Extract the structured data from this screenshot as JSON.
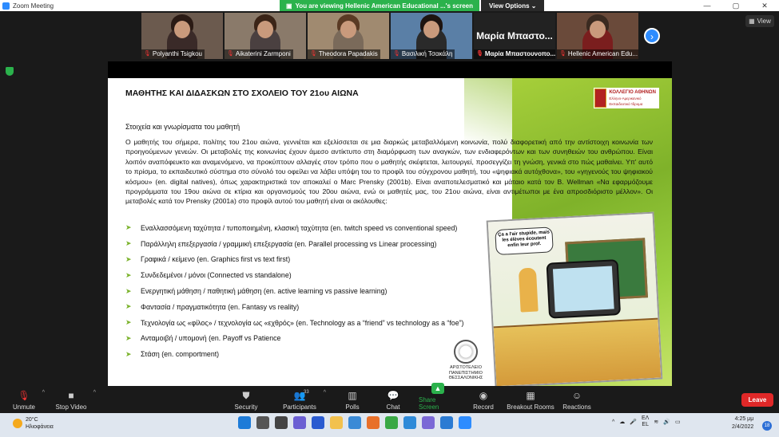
{
  "window": {
    "title": "Zoom Meeting",
    "controls": [
      "—",
      "▢",
      "✕"
    ]
  },
  "share_banner": {
    "text": "You are viewing Hellenic American Educational ...'s screen",
    "view_options": "View Options"
  },
  "participants": [
    {
      "name": "Polyanthi Tsigkou",
      "color": "#6b5a4e",
      "hair": "#2a1a14",
      "shirt": "#3a2a28"
    },
    {
      "name": "Aikaterini Zarmponi",
      "color": "#8a7a6a",
      "hair": "#3b2417",
      "shirt": "#4a4040"
    },
    {
      "name": "Theodora Papadakis",
      "color": "#a08a70",
      "hair": "#5a3a24",
      "shirt": "#7a6a5a"
    },
    {
      "name": "Βασιλική Τσακάλη",
      "color": "#5a7fa6",
      "hair": "#1e1410",
      "shirt": "#2a2a2a"
    },
    {
      "name": "Μαρία Μπαστουνοπο...",
      "display": "Μαρία Μπαστο..."
    },
    {
      "name": "Hellenic American Edu...",
      "color": "#6a4a3a",
      "hair": "#3a2a20",
      "shirt": "#7a1e1e"
    }
  ],
  "view_button": "View",
  "slide": {
    "title": "ΜΑΘΗΤΗΣ ΚΑΙ ΔΙΔΑΣΚΩΝ ΣΤΟ ΣΧΟΛΕΙΟ ΤΟΥ 21ου ΑΙΩΝΑ",
    "logo_text": "ΚΟΛΛΕΓΙΟ ΑΘΗΝΩΝ",
    "logo_sub": "Ελληνο-Αμερικανικό Εκπαιδευτικό Ίδρυμα",
    "subtitle": "Στοιχεία και γνωρίσματα του μαθητή",
    "paragraph": "Ο μαθητής του σήμερα, πολίτης του 21ου αιώνα, γεννιέται και εξελίσσεται σε μια διαρκώς μεταβαλλόμενη κοινωνία, πολύ διαφορετική από την αντίστοιχη κοινωνία των προηγούμενων γενεών. Οι μεταβολές της κοινωνίας έχουν άμεσο αντίκτυπο στη διαμόρφωση των αναγκών, των ενδιαφερόντων και των συνηθειών του ανθρώπου. Είναι λοιπόν αναπόφευκτο και αναμενόμενο, να προκύπτουν αλλαγές στον τρόπο που ο μαθητής σκέφτεται, λειτουργεί, προσεγγίζει τη γνώση, γενικά στο πώς μαθαίνει. Υπ' αυτό το πρίσμα, το εκπαιδευτικό σύστημα στο σύνολό του οφείλει να λάβει υπόψη του το προφίλ του σύγχρονου μαθητή, του «ψηφιακά αυτόχθονα», του «γηγενούς του ψηφιακού κόσμου» (en. digital natives), όπως χαρακτηριστικά τον αποκαλεί ο Marc Prensky (2001b). Είναι αναποτελεσματικό και μάταιο κατά τον B. Wellman «Να εφαρμόζουμε προγράμματα του 19ου αιώνα σε κτίρια και οργανισμούς του 20ου αιώνα, ενώ οι μαθητές μας, του 21ου αιώνα, είναι αντιμέτωποι με ένα απροσδιόριστο μέλλον». Οι μεταβολές κατά τον Prensky (2001a) στο προφίλ αυτού του μαθητή είναι οι ακόλουθες:",
    "bullets": [
      "Εναλλασσόμενη ταχύτητα / τυποποιημένη, κλασική ταχύτητα (en. twitch speed vs conventional speed)",
      "Παράλληλη επεξεργασία / γραμμική επεξεργασία (en. Parallel processing vs Linear processing)",
      "Γραφικά / κείμενο (en. Graphics first vs text first)",
      "Συνδεδεμένοι / μόνοι  (Connected vs standalone)",
      "Ενεργητική μάθηση / παθητική μάθηση (en. active learning vs passive learning)",
      "Φαντασία / πραγματικότητα (en. Fantasy vs reality)",
      "Τεχνολογία ως «φίλος» / τεχνολογία ως «εχθρός» (en. Technology as a “friend” vs technology as a “foe”)",
      "Ανταμοιβή / υπομονή  (en. Payoff vs Patience",
      "Στάση (en. comportment)"
    ],
    "university": [
      "ΑΡΙΣΤΟΤΕΛΕΙΟ",
      "ΠΑΝΕΠΙΣΤΗΜΙΟ",
      "ΘΕΣΣΑΛΟΝΙΚΗΣ"
    ],
    "cartoon_bubble": "Ça a l'air stupide, mais les élèves écoutent enfin leur prof."
  },
  "toolbar": {
    "unmute": "Unmute",
    "stop_video": "Stop Video",
    "security": "Security",
    "participants": "Participants",
    "participant_count": "33",
    "polls": "Polls",
    "chat": "Chat",
    "share_screen": "Share Screen",
    "record": "Record",
    "breakout": "Breakout Rooms",
    "reactions": "Reactions",
    "leave": "Leave"
  },
  "taskbar": {
    "temp": "20°C",
    "weather": "Ηλιοφάνεια",
    "lang": "ΕΛ",
    "lang2": "EL",
    "time": "4:25 μμ",
    "date": "2/4/2022",
    "notifications": "18"
  }
}
